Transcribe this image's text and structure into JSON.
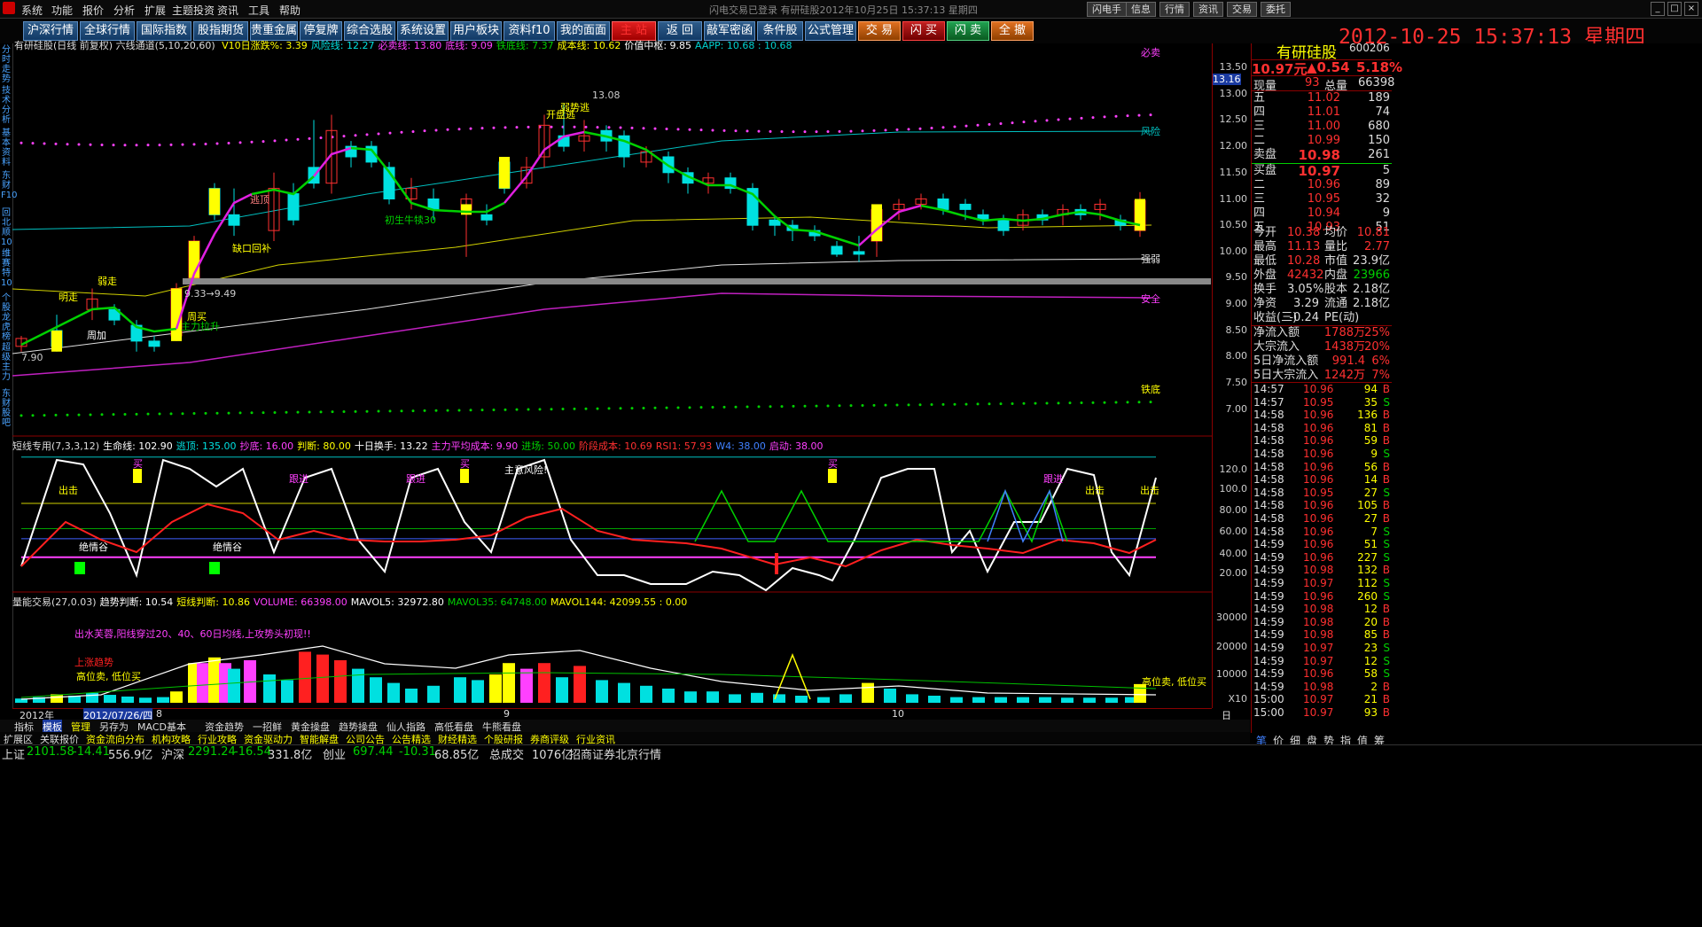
{
  "menubar": {
    "items": [
      "系统",
      "功能",
      "报价",
      "分析",
      "扩展",
      "主题投资",
      "资讯",
      "工具",
      "帮助"
    ],
    "window_title": "闪电交易已登录    有研硅股2012年10月25日 15:37:13 星期四",
    "right_buttons": [
      "闪电手",
      "信息",
      "行情",
      "资讯",
      "交易",
      "委托"
    ]
  },
  "toolbar": {
    "buttons": [
      "沪深行情",
      "全球行情",
      "国际指数",
      "股指期货",
      "贵重金属",
      "停复牌",
      "综合选股",
      "系统设置",
      "用户板块",
      "资料f10",
      "我的面面",
      "主 站",
      "返 回",
      "敲军密函",
      "条件股",
      "公式管理",
      "交 易",
      "闪 买",
      "闪 卖",
      "全 撤"
    ],
    "clock": "2012-10-25 15:37:13 星期四"
  },
  "leftnav": [
    "分时走势",
    "技术分析",
    "基本资料",
    "东财F10",
    "回北顺10",
    "维赛特10",
    "个股龙虎榜",
    "超级主力",
    "东财股吧"
  ],
  "main_chart": {
    "header_left": "有研硅股(日线 前复权) 六线通道(5,10,20,60)",
    "header_items": [
      {
        "label": "V10日涨跌%: 3.39",
        "color": "#ffff00"
      },
      {
        "label": "风险线: 12.27",
        "color": "#00e0e0"
      },
      {
        "label": "必卖线: 13.80",
        "color": "#ff40ff"
      },
      {
        "label": "底线: 9.09",
        "color": "#ff40ff"
      },
      {
        "label": "铁底线: 7.37",
        "color": "#00d000"
      },
      {
        "label": "成本线: 10.62",
        "color": "#ffff00"
      },
      {
        "label": "价值中枢: 9.85",
        "color": "#ffffff"
      },
      {
        "label": "AAPP: 10.68 : 10.68",
        "color": "#00d0d0"
      }
    ],
    "price_axis": [
      "13.50",
      "13.00",
      "12.50",
      "12.00",
      "11.50",
      "11.00",
      "10.50",
      "10.00",
      "9.50",
      "9.00",
      "8.50",
      "8.00",
      "7.50",
      "7.00"
    ],
    "current_price_tag": "13.16",
    "line_labels": [
      "必卖",
      "风险",
      "安全",
      "强弱",
      "铁底"
    ],
    "annotations": [
      "明走",
      "逃顶",
      "开盘逃",
      "弱走",
      "周加",
      "主力拉升",
      "周买",
      "缺口回补",
      "初生牛犊30",
      "弱势逃",
      "13.08",
      "7.90",
      "9.33→9.49"
    ]
  },
  "short_chart": {
    "header": [
      {
        "label": "短线专用(7,3,3,12)",
        "color": "#ddd"
      },
      {
        "label": "生命线: 102.90",
        "color": "#ffffff"
      },
      {
        "label": "逃顶: 135.00",
        "color": "#00e0e0"
      },
      {
        "label": "抄底: 16.00",
        "color": "#ff40ff"
      },
      {
        "label": "判断: 80.00",
        "color": "#ffff00"
      },
      {
        "label": "十日换手: 13.22",
        "color": "#ffffff"
      },
      {
        "label": "主力平均成本: 9.90",
        "color": "#ff40ff"
      },
      {
        "label": "进场: 50.00",
        "color": "#00d000"
      },
      {
        "label": "阶段成本: 10.69",
        "color": "#ff3030"
      },
      {
        "label": "RSI1: 57.93",
        "color": "#ff3030"
      },
      {
        "label": "W4: 38.00",
        "color": "#4080ff"
      },
      {
        "label": "启动: 38.00",
        "color": "#ff40ff"
      }
    ],
    "axis": [
      "120.0",
      "100.0",
      "80.00",
      "60.00",
      "40.00",
      "20.00"
    ],
    "labels": [
      "买",
      "跟进",
      "出击",
      "绝情谷",
      "主意风险!"
    ]
  },
  "volume_chart": {
    "header": [
      {
        "label": "量能交易(27,0.03)",
        "color": "#ddd"
      },
      {
        "label": "趋势判断: 10.54",
        "color": "#ffffff"
      },
      {
        "label": "短线判断: 10.86",
        "color": "#ffff00"
      },
      {
        "label": "VOLUME: 66398.00",
        "color": "#ff40ff"
      },
      {
        "label": "MAVOL5: 32972.80",
        "color": "#ffffff"
      },
      {
        "label": "MAVOL35: 64748.00",
        "color": "#00d000"
      },
      {
        "label": "MAVOL144: 42099.55 : 0.00",
        "color": "#ffff00"
      }
    ],
    "axis": [
      "30000",
      "20000",
      "10000",
      "X10"
    ],
    "notes": [
      "出水芙蓉,阳线穿过20、40、60日均线,上攻势头初现!!",
      "上涨趋势",
      "高位卖, 低位买"
    ]
  },
  "date_axis": [
    "2012年",
    "2012/07/26/四",
    "8",
    "9",
    "10",
    "日线"
  ],
  "bottom_tabs1": [
    "指标",
    "模板",
    "管理",
    "另存为",
    "MACD基本",
    "资金趋势",
    "一招鲜",
    "黄金操盘",
    "趋势操盘",
    "仙人指路",
    "高低看盘",
    "牛熊看盘"
  ],
  "bottom_tabs2": [
    "扩展区",
    "关联报价",
    "资金流向分布",
    "机构攻略",
    "行业攻略",
    "资金驱动力",
    "智能解盘",
    "公司公告",
    "公告精选",
    "财经精选",
    "个股研报",
    "券商评级",
    "行业资讯"
  ],
  "right_panel": {
    "stock_name": "有研硅股",
    "stock_code": "600206",
    "price": "10.97元",
    "change": "▲0.54",
    "change_pct": "5.18%",
    "now_label": "现量",
    "now_val": "93",
    "total_label": "总量",
    "total_val": "66398",
    "sell_levels": [
      {
        "name": "五",
        "price": "11.02",
        "vol": "189"
      },
      {
        "name": "四",
        "price": "11.01",
        "vol": "74"
      },
      {
        "name": "三",
        "price": "11.00",
        "vol": "680"
      },
      {
        "name": "二",
        "price": "10.99",
        "vol": "150"
      },
      {
        "name": "卖盘",
        "price": "10.98",
        "vol": "261"
      }
    ],
    "buy_levels": [
      {
        "name": "买盘",
        "price": "10.97",
        "vol": "5"
      },
      {
        "name": "二",
        "price": "10.96",
        "vol": "89"
      },
      {
        "name": "三",
        "price": "10.95",
        "vol": "32"
      },
      {
        "name": "四",
        "price": "10.94",
        "vol": "9"
      },
      {
        "name": "五",
        "price": "10.93",
        "vol": "51"
      }
    ],
    "stats": [
      {
        "k1": "今开",
        "v1": "10.38",
        "k2": "均价",
        "v2": "10.81",
        "c1": "red",
        "c2": "red"
      },
      {
        "k1": "最高",
        "v1": "11.13",
        "k2": "量比",
        "v2": "2.77",
        "c1": "red",
        "c2": "red"
      },
      {
        "k1": "最低",
        "v1": "10.28",
        "k2": "市值",
        "v2": "23.9亿",
        "c1": "red",
        "c2": "wht"
      },
      {
        "k1": "外盘",
        "v1": "42432",
        "k2": "内盘",
        "v2": "23966",
        "c1": "red",
        "c2": "grn"
      },
      {
        "k1": "换手",
        "v1": "3.05%",
        "k2": "股本",
        "v2": "2.18亿",
        "c1": "wht",
        "c2": "wht"
      },
      {
        "k1": "净资",
        "v1": "3.29",
        "k2": "流通",
        "v2": "2.18亿",
        "c1": "wht",
        "c2": "wht"
      },
      {
        "k1": "收益(三)",
        "v1": "-0.24",
        "k2": "PE(动)",
        "v2": "",
        "c1": "wht",
        "c2": "wht"
      }
    ],
    "flows": [
      {
        "k": "净流入额",
        "v": "1788万",
        "p": "25%"
      },
      {
        "k": "大宗流入",
        "v": "1438万",
        "p": "20%"
      },
      {
        "k": "5日净流入额",
        "v": "991.4万",
        "p": "6%"
      },
      {
        "k": "5日大宗流入",
        "v": "1242万",
        "p": "7%"
      }
    ],
    "ticks": [
      [
        "14:57",
        "10.96",
        "94",
        "B"
      ],
      [
        "14:57",
        "10.95",
        "35",
        "S"
      ],
      [
        "14:58",
        "10.96",
        "136",
        "B"
      ],
      [
        "14:58",
        "10.96",
        "81",
        "B"
      ],
      [
        "14:58",
        "10.96",
        "59",
        "B"
      ],
      [
        "14:58",
        "10.96",
        "9",
        "S"
      ],
      [
        "14:58",
        "10.96",
        "56",
        "B"
      ],
      [
        "14:58",
        "10.96",
        "14",
        "B"
      ],
      [
        "14:58",
        "10.95",
        "27",
        "S"
      ],
      [
        "14:58",
        "10.96",
        "105",
        "B"
      ],
      [
        "14:58",
        "10.96",
        "27",
        "B"
      ],
      [
        "14:58",
        "10.96",
        "7",
        "S"
      ],
      [
        "14:59",
        "10.96",
        "51",
        "S"
      ],
      [
        "14:59",
        "10.96",
        "227",
        "S"
      ],
      [
        "14:59",
        "10.98",
        "132",
        "B"
      ],
      [
        "14:59",
        "10.97",
        "112",
        "S"
      ],
      [
        "14:59",
        "10.96",
        "260",
        "S"
      ],
      [
        "14:59",
        "10.98",
        "12",
        "B"
      ],
      [
        "14:59",
        "10.98",
        "20",
        "B"
      ],
      [
        "14:59",
        "10.98",
        "85",
        "B"
      ],
      [
        "14:59",
        "10.97",
        "23",
        "S"
      ],
      [
        "14:59",
        "10.97",
        "12",
        "S"
      ],
      [
        "14:59",
        "10.96",
        "58",
        "S"
      ],
      [
        "14:59",
        "10.98",
        "2",
        "B"
      ],
      [
        "15:00",
        "10.97",
        "21",
        "B"
      ],
      [
        "15:00",
        "10.97",
        "93",
        "B"
      ]
    ],
    "tabs": [
      "笔",
      "价",
      "细",
      "盘",
      "势",
      "指",
      "值",
      "筹"
    ]
  },
  "statusbar": [
    {
      "t": "上证",
      "c": "wht"
    },
    {
      "t": "2101.58",
      "c": "grn"
    },
    {
      "t": "-14.41",
      "c": "grn"
    },
    {
      "t": "556.9亿",
      "c": "wht"
    },
    {
      "t": "沪深",
      "c": "wht"
    },
    {
      "t": "2291.24",
      "c": "grn"
    },
    {
      "t": "-16.54",
      "c": "grn"
    },
    {
      "t": "331.8亿",
      "c": "wht"
    },
    {
      "t": "创业",
      "c": "wht"
    },
    {
      "t": "697.44",
      "c": "grn"
    },
    {
      "t": "-10.31",
      "c": "grn"
    },
    {
      "t": "68.85亿",
      "c": "wht"
    },
    {
      "t": "总成交",
      "c": "wht"
    },
    {
      "t": "1076亿",
      "c": "wht"
    },
    {
      "t": "招商证券北京行情",
      "c": "wht"
    }
  ]
}
